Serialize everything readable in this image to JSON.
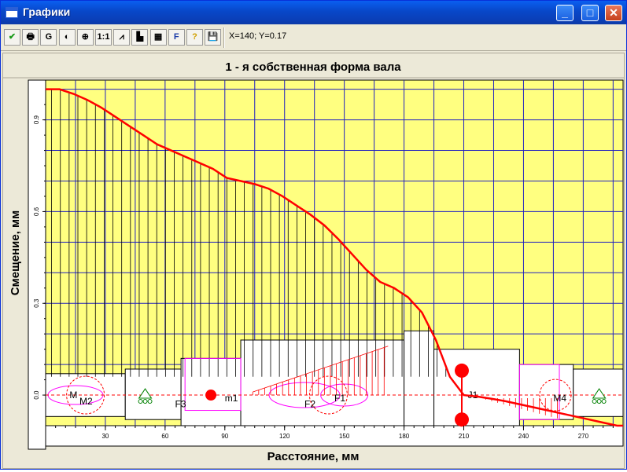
{
  "window": {
    "title": "Графики"
  },
  "window_controls": {
    "minimize": "_",
    "maximize": "□",
    "close": "✕"
  },
  "toolbar": {
    "coords": "X=140; Y=0.17",
    "buttons": [
      {
        "name": "apply-button",
        "label": "✔",
        "icon": "checkmark-icon"
      },
      {
        "name": "print-button",
        "label": "🖶",
        "icon": "printer-icon"
      },
      {
        "name": "grid-button",
        "label": "G",
        "icon": "grid-icon"
      },
      {
        "name": "palette-button",
        "label": "◐",
        "icon": "palette-icon"
      },
      {
        "name": "zoom-in-button",
        "label": "⊕",
        "icon": "zoom-in-icon"
      },
      {
        "name": "zoom-1-1-button",
        "label": "1:1",
        "icon": "zoom-reset-icon"
      },
      {
        "name": "chart-settings-button",
        "label": "⩘",
        "icon": "chart-icon"
      },
      {
        "name": "bar-chart-button",
        "label": "▙",
        "icon": "bar-chart-icon"
      },
      {
        "name": "table-button",
        "label": "▦",
        "icon": "table-icon"
      },
      {
        "name": "font-button",
        "label": "F",
        "icon": "font-icon"
      },
      {
        "name": "help-button",
        "label": "?",
        "icon": "help-icon"
      },
      {
        "name": "save-button",
        "label": "💾",
        "icon": "floppy-icon"
      }
    ]
  },
  "chart_data": {
    "type": "line",
    "title": "1 - я собственная форма вала",
    "xlabel": "Расстояние, мм",
    "ylabel": "Смещение, мм",
    "xlim": [
      0,
      290
    ],
    "ylim": [
      -0.1,
      1.03
    ],
    "x_ticks": [
      30,
      60,
      90,
      120,
      150,
      180,
      210,
      240,
      270
    ],
    "y_ticks": [
      0.0,
      0.3,
      0.6,
      0.9
    ],
    "y_tick_labels": [
      "0.0",
      "0.3",
      "0.6",
      "0.9"
    ],
    "grid": true,
    "colors": {
      "plot_background": "#ffff80",
      "grid": "#2020c0",
      "curve": "#ff0000",
      "shaft": "#000000",
      "loads": "#ff00ff"
    },
    "series": [
      {
        "x": [
          0,
          7,
          14,
          21,
          28,
          35,
          42,
          49,
          56,
          63,
          70,
          77,
          84,
          91,
          98,
          105,
          112,
          119,
          126,
          133,
          140,
          147,
          154,
          161,
          168,
          175,
          182,
          189,
          196,
          203,
          210,
          217,
          224,
          231,
          238,
          245,
          252,
          259,
          266,
          273,
          280,
          287,
          290
        ],
        "values": [
          1.0,
          1.0,
          0.985,
          0.965,
          0.94,
          0.91,
          0.88,
          0.85,
          0.82,
          0.8,
          0.78,
          0.76,
          0.74,
          0.71,
          0.7,
          0.69,
          0.675,
          0.65,
          0.62,
          0.59,
          0.555,
          0.51,
          0.46,
          0.41,
          0.37,
          0.35,
          0.32,
          0.27,
          0.18,
          0.06,
          0.0,
          -0.005,
          -0.012,
          -0.02,
          -0.03,
          -0.04,
          -0.05,
          -0.06,
          -0.07,
          -0.08,
          -0.09,
          -0.1,
          -0.1
        ]
      }
    ],
    "annotations": [
      "M",
      "M2",
      "F3",
      "m1",
      "F2",
      "F1",
      "J1",
      "M4"
    ]
  }
}
